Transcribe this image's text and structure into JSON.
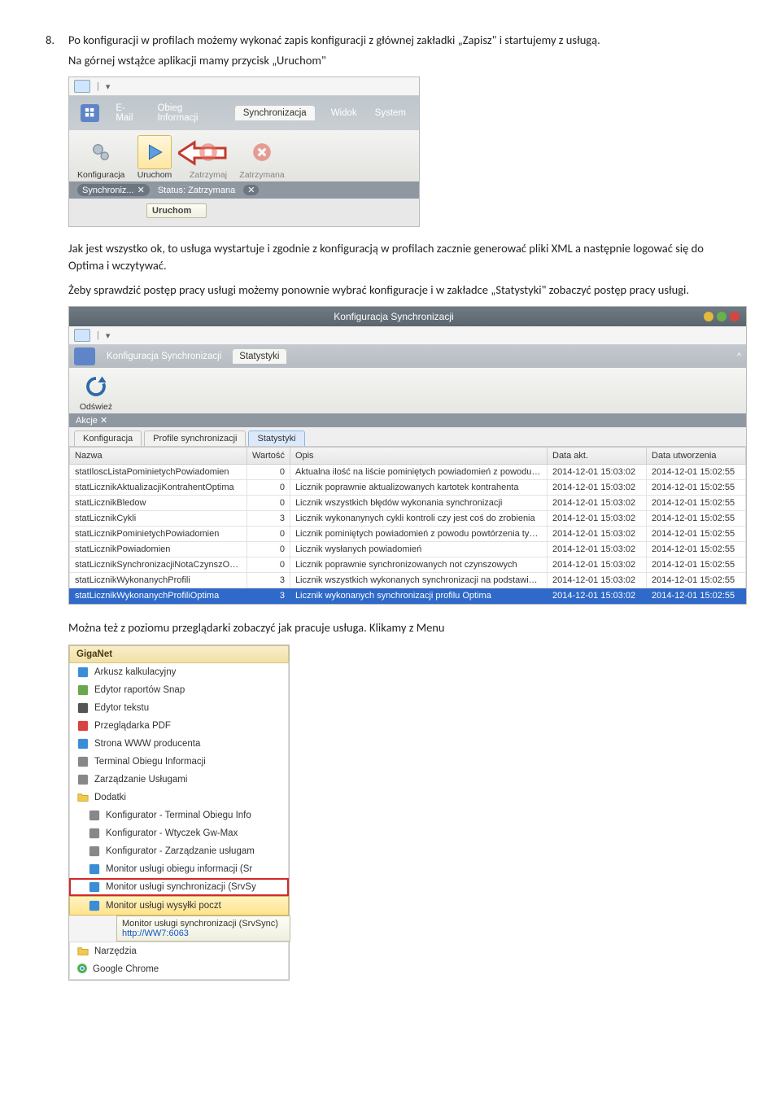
{
  "doc": {
    "item8_num": "8.",
    "item8_text": "Po konfiguracji w profilach możemy wykonać zapis konfiguracji z głównej zakładki „Zapisz\" i startujemy z usługą.",
    "p2": "Na górnej wstążce aplikacji mamy przycisk „Uruchom\"",
    "p3": "Jak jest wszystko ok, to usługa wystartuje i zgodnie z konfiguracją w profilach zacznie generować pliki XML a następnie logować się do Optima i wczytywać.",
    "p4": "Żeby sprawdzić postęp pracy usługi możemy ponownie wybrać konfiguracje i w zakładce „Statystyki\" zobaczyć  postęp pracy usługi.",
    "p5": "Można też z poziomu przeglądarki zobaczyć jak pracuje usługa. Klikamy z Menu"
  },
  "shot1": {
    "tabs": [
      "E-Mail",
      "Obieg Informacji",
      "Synchronizacja",
      "Widok",
      "System"
    ],
    "active_tab_index": 2,
    "ribbon": [
      {
        "label": "Konfiguracja"
      },
      {
        "label": "Uruchom"
      },
      {
        "label": "Zatrzymaj"
      },
      {
        "label": "Zatrzymana"
      }
    ],
    "status_left": "Synchroniz...",
    "status_mid": "Status: Zatrzymana",
    "tooltip": "Uruchom"
  },
  "shot2": {
    "window_title": "Konfiguracja Synchronizacji",
    "tab1": "Konfiguracja Synchronizacji",
    "tab2": "Statystyki",
    "refresh": "Odśwież",
    "akcje": "Akcje",
    "subtabs": [
      "Konfiguracja",
      "Profile synchronizacji",
      "Statystyki"
    ],
    "active_subtab_index": 2,
    "columns": [
      "Nazwa",
      "Wartość",
      "Opis",
      "Data akt.",
      "Data utworzenia"
    ],
    "rows": [
      {
        "n": "statIloscListaPominietychPowiadomien",
        "v": "0",
        "o": "Aktualna ilość na liście pominiętych powiadomień z powodu powtórzenia",
        "d1": "2014-12-01 15:03:02",
        "d2": "2014-12-01 15:02:55"
      },
      {
        "n": "statLicznikAktualizacjiKontrahentOptima",
        "v": "0",
        "o": "Licznik poprawnie aktualizowanych kartotek kontrahenta",
        "d1": "2014-12-01 15:03:02",
        "d2": "2014-12-01 15:02:55"
      },
      {
        "n": "statLicznikBledow",
        "v": "0",
        "o": "Licznik wszystkich błędów wykonania synchronizacji",
        "d1": "2014-12-01 15:03:02",
        "d2": "2014-12-01 15:02:55"
      },
      {
        "n": "statLicznikCykli",
        "v": "3",
        "o": "Licznik wykonanynych cykli kontroli czy jest coś do zrobienia",
        "d1": "2014-12-01 15:03:02",
        "d2": "2014-12-01 15:02:55"
      },
      {
        "n": "statLicznikPominietychPowiadomien",
        "v": "0",
        "o": "Licznik pominiętych powiadomień z powodu powtórzenia typu i klucza powi...",
        "d1": "2014-12-01 15:03:02",
        "d2": "2014-12-01 15:02:55"
      },
      {
        "n": "statLicznikPowiadomien",
        "v": "0",
        "o": "Licznik wysłanych powiadomień",
        "d1": "2014-12-01 15:03:02",
        "d2": "2014-12-01 15:02:55"
      },
      {
        "n": "statLicznikSynchronizacjiNotaCzynszOptima",
        "v": "0",
        "o": "Licznik poprawnie synchronizowanych not czynszowych",
        "d1": "2014-12-01 15:03:02",
        "d2": "2014-12-01 15:02:55"
      },
      {
        "n": "statLicznikWykonanychProfili",
        "v": "3",
        "o": "Licznik wszystkich wykonanych synchronizacji na podstawie profili",
        "d1": "2014-12-01 15:03:02",
        "d2": "2014-12-01 15:02:55"
      },
      {
        "n": "statLicznikWykonanychProfiliOptima",
        "v": "3",
        "o": "Licznik wykonanych synchronizacji profilu Optima",
        "d1": "2014-12-01 15:03:02",
        "d2": "2014-12-01 15:02:55"
      }
    ],
    "selected_row_index": 8
  },
  "shot3": {
    "header": "GigaNet",
    "items": [
      "Arkusz kalkulacyjny",
      "Edytor raportów Snap",
      "Edytor tekstu",
      "Przeglądarka PDF",
      "Strona WWW producenta",
      "Terminal Obiegu Informacji",
      "Zarządzanie Usługami",
      "Dodatki",
      "Konfigurator - Terminal Obiegu Info",
      "Konfigurator - Wtyczek Gw-Max",
      "Konfigurator - Zarządzanie usługam",
      "Monitor usługi obiegu informacji (Sr",
      "Monitor usługi synchronizacji (SrvSy",
      "Monitor usługi wysyłki poczt",
      "Narzędzia",
      "Google Chrome"
    ],
    "tooltip_title": "Monitor usługi synchronizacji (SrvSync)",
    "tooltip_url": "http://WW7:6063"
  }
}
